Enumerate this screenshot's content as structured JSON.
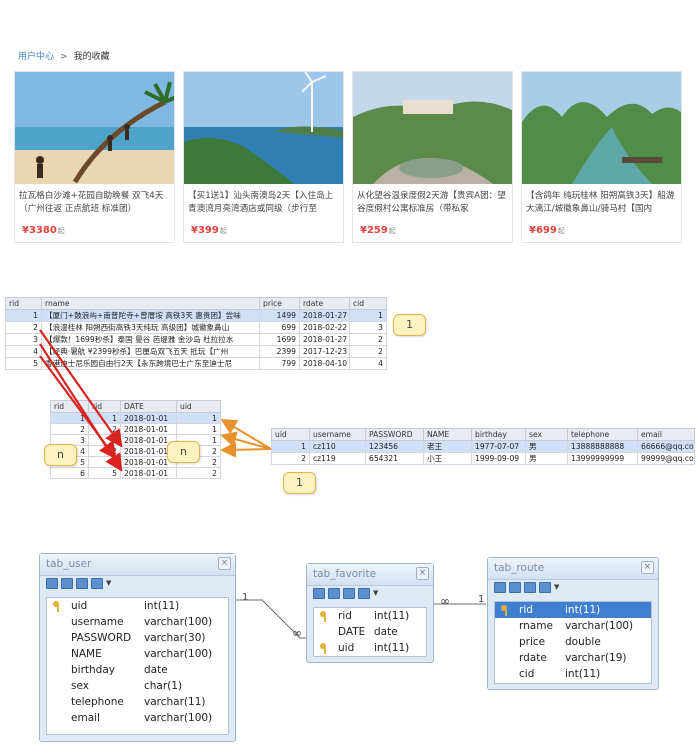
{
  "breadcrumb": {
    "home": "用户中心",
    "separator": ">",
    "current": "我的收藏"
  },
  "cards": [
    {
      "title": "拉瓦格白沙滩+花园自助晚餐 双飞4天（广州往返 正点航班 标准团）",
      "price": "¥3380",
      "unit": "起"
    },
    {
      "title": "【买1送1】汕头南澳岛2天【入住岛上青澳湾月亮湾酒店或同级（步行至",
      "price": "¥399",
      "unit": "起"
    },
    {
      "title": "从化望谷温泉度假2天游【贵宾A团：望谷度假村公寓标准房（带私家",
      "price": "¥259",
      "unit": "起"
    },
    {
      "title": "【含鸽年 纯玩桂林 阳朔高铁3天】船游大漓江/城徽象鼻山/骑马村【国内",
      "price": "¥699",
      "unit": "起"
    }
  ],
  "route_table": {
    "columns": [
      "rid",
      "rname",
      "price",
      "rdate",
      "cid"
    ],
    "rows": [
      [
        "1",
        "【厦门+鼓浪屿+南普陀寺+曾厝垵 高铁3天 惠贵团】尝味",
        "1499",
        "2018-01-27",
        "1"
      ],
      [
        "2",
        "【浪漫桂林 阳朔西街高铁3天纯玩 高级团】城徽象鼻山",
        "699",
        "2018-02-22",
        "3"
      ],
      [
        "3",
        "【爆款！1699秒杀】泰国 曼谷 芭堤雅 金沙岛 杜拉拉水",
        "1699",
        "2018-01-27",
        "2"
      ],
      [
        "4",
        "【经典·暑航 ¥2399秒杀】巴厘岛双飞五天 抵玩【广州",
        "2399",
        "2017-12-23",
        "2"
      ],
      [
        "5",
        "香港迪士尼乐园自由行2天【永东跨境巴士广东至迪士尼",
        "799",
        "2018-04-10",
        "4"
      ]
    ]
  },
  "favorite_table": {
    "columns": [
      "rid",
      "rid",
      "DATE",
      "uid"
    ],
    "rows": [
      [
        "1",
        "1",
        "2018-01-01",
        "1"
      ],
      [
        "2",
        "2",
        "2018-01-01",
        "1"
      ],
      [
        "3",
        "3",
        "2018-01-01",
        "1"
      ],
      [
        "4",
        "2",
        "2018-01-01",
        "2"
      ],
      [
        "5",
        "3",
        "2018-01-01",
        "2"
      ],
      [
        "6",
        "5",
        "2018-01-01",
        "2"
      ]
    ]
  },
  "user_table": {
    "columns": [
      "uid",
      "username",
      "PASSWORD",
      "NAME",
      "birthday",
      "sex",
      "telephone",
      "email"
    ],
    "rows": [
      [
        "1",
        "cz110",
        "123456",
        "老王",
        "1977-07-07",
        "男",
        "13888888888",
        "66666@qq.co"
      ],
      [
        "2",
        "cz119",
        "654321",
        "小王",
        "1999-09-09",
        "男",
        "13999999999",
        "99999@qq.co"
      ]
    ]
  },
  "badges": {
    "route": "1",
    "user": "1",
    "fav_left": "n",
    "fav_mid": "n"
  },
  "er": {
    "tab_user": {
      "title": "tab_user",
      "fields": [
        {
          "name": "uid",
          "type": "int(11)",
          "key": true
        },
        {
          "name": "username",
          "type": "varchar(100)"
        },
        {
          "name": "PASSWORD",
          "type": "varchar(30)"
        },
        {
          "name": "NAME",
          "type": "varchar(100)"
        },
        {
          "name": "birthday",
          "type": "date"
        },
        {
          "name": "sex",
          "type": "char(1)"
        },
        {
          "name": "telephone",
          "type": "varchar(11)"
        },
        {
          "name": "email",
          "type": "varchar(100)"
        }
      ]
    },
    "tab_favorite": {
      "title": "tab_favorite",
      "fields": [
        {
          "name": "rid",
          "type": "int(11)",
          "key": true
        },
        {
          "name": "DATE",
          "type": "date"
        },
        {
          "name": "uid",
          "type": "int(11)",
          "key": true
        }
      ]
    },
    "tab_route": {
      "title": "tab_route",
      "fields": [
        {
          "name": "rid",
          "type": "int(11)",
          "key": true,
          "selected": true
        },
        {
          "name": "rname",
          "type": "varchar(100)"
        },
        {
          "name": "price",
          "type": "double"
        },
        {
          "name": "rdate",
          "type": "varchar(19)"
        },
        {
          "name": "cid",
          "type": "int(11)"
        }
      ]
    },
    "relations": {
      "user_side": "1",
      "fav_side_left": "∞",
      "fav_side_right": "∞",
      "route_side": "1"
    }
  },
  "colors": {
    "accent": "#3b86c9",
    "price": "#e0433a",
    "selection": "#3f7fd1",
    "arrow_red": "#d9231f",
    "arrow_orange": "#e8902b"
  }
}
